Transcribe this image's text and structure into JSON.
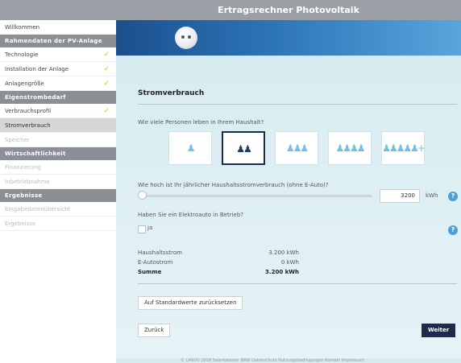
{
  "header": {
    "title": "Ertragsrechner Photovoltaik"
  },
  "sidebar": {
    "welcome": "Willkommen",
    "groups": [
      {
        "title": "Rahmendaten der PV-Anlage",
        "items": [
          {
            "label": "Technologie",
            "done": true
          },
          {
            "label": "Installation der Anlage",
            "done": true
          },
          {
            "label": "Anlagengröße",
            "done": true
          }
        ]
      },
      {
        "title": "Eigenstrombedarf",
        "items": [
          {
            "label": "Verbrauchsprofil",
            "done": true
          },
          {
            "label": "Stromverbrauch",
            "active": true
          },
          {
            "label": "Speicher",
            "disabled": true
          }
        ]
      },
      {
        "title": "Wirtschaftlichkeit",
        "items": [
          {
            "label": "Finanzierung",
            "disabled": true
          },
          {
            "label": "Inbetriebnahme",
            "disabled": true
          }
        ]
      },
      {
        "title": "Ergebnisse",
        "items": [
          {
            "label": "Eingabedatenübersicht",
            "disabled": true
          },
          {
            "label": "Ergebnisse",
            "disabled": true
          }
        ]
      }
    ],
    "check_glyph": "✓"
  },
  "main": {
    "section_title": "Stromverbrauch",
    "q_persons": "Wie viele Personen leben in Ihrem Haushalt?",
    "persons": [
      {
        "count": 1,
        "selected": false
      },
      {
        "count": 2,
        "selected": true
      },
      {
        "count": 3,
        "selected": false
      },
      {
        "count": 4,
        "selected": false
      },
      {
        "count": 5,
        "selected": false,
        "plus": "+"
      }
    ],
    "q_consumption": "Wie hoch ist Ihr jährlicher Haushaltsstromverbrauch (ohne E-Auto)?",
    "consumption_value": "3200",
    "consumption_unit": "kWh",
    "help_glyph": "?",
    "q_ecar": "Haben Sie ein Elektroauto in Betrieb?",
    "ecar_option": "ja",
    "summary": [
      {
        "label": "Haushaltsstrom",
        "value": "3.200 kWh"
      },
      {
        "label": "E-Autostrom",
        "value": "0 kWh"
      },
      {
        "label": "Summe",
        "value": "3.200 kWh",
        "total": true
      }
    ],
    "reset_label": "Auf Standardwerte zurücksetzen",
    "back_label": "Zurück",
    "next_label": "Weiter"
  },
  "footer": {
    "text": "© LANUV 2018  Solarkataster NRW  Datenschutz  Nutzungsbedingungen  Kontakt  Impressum"
  },
  "colors": {
    "accent_dark": "#1e2a4a",
    "check": "#f0b429",
    "help": "#4a9fd6",
    "figure_light": "#6fc2e6"
  }
}
